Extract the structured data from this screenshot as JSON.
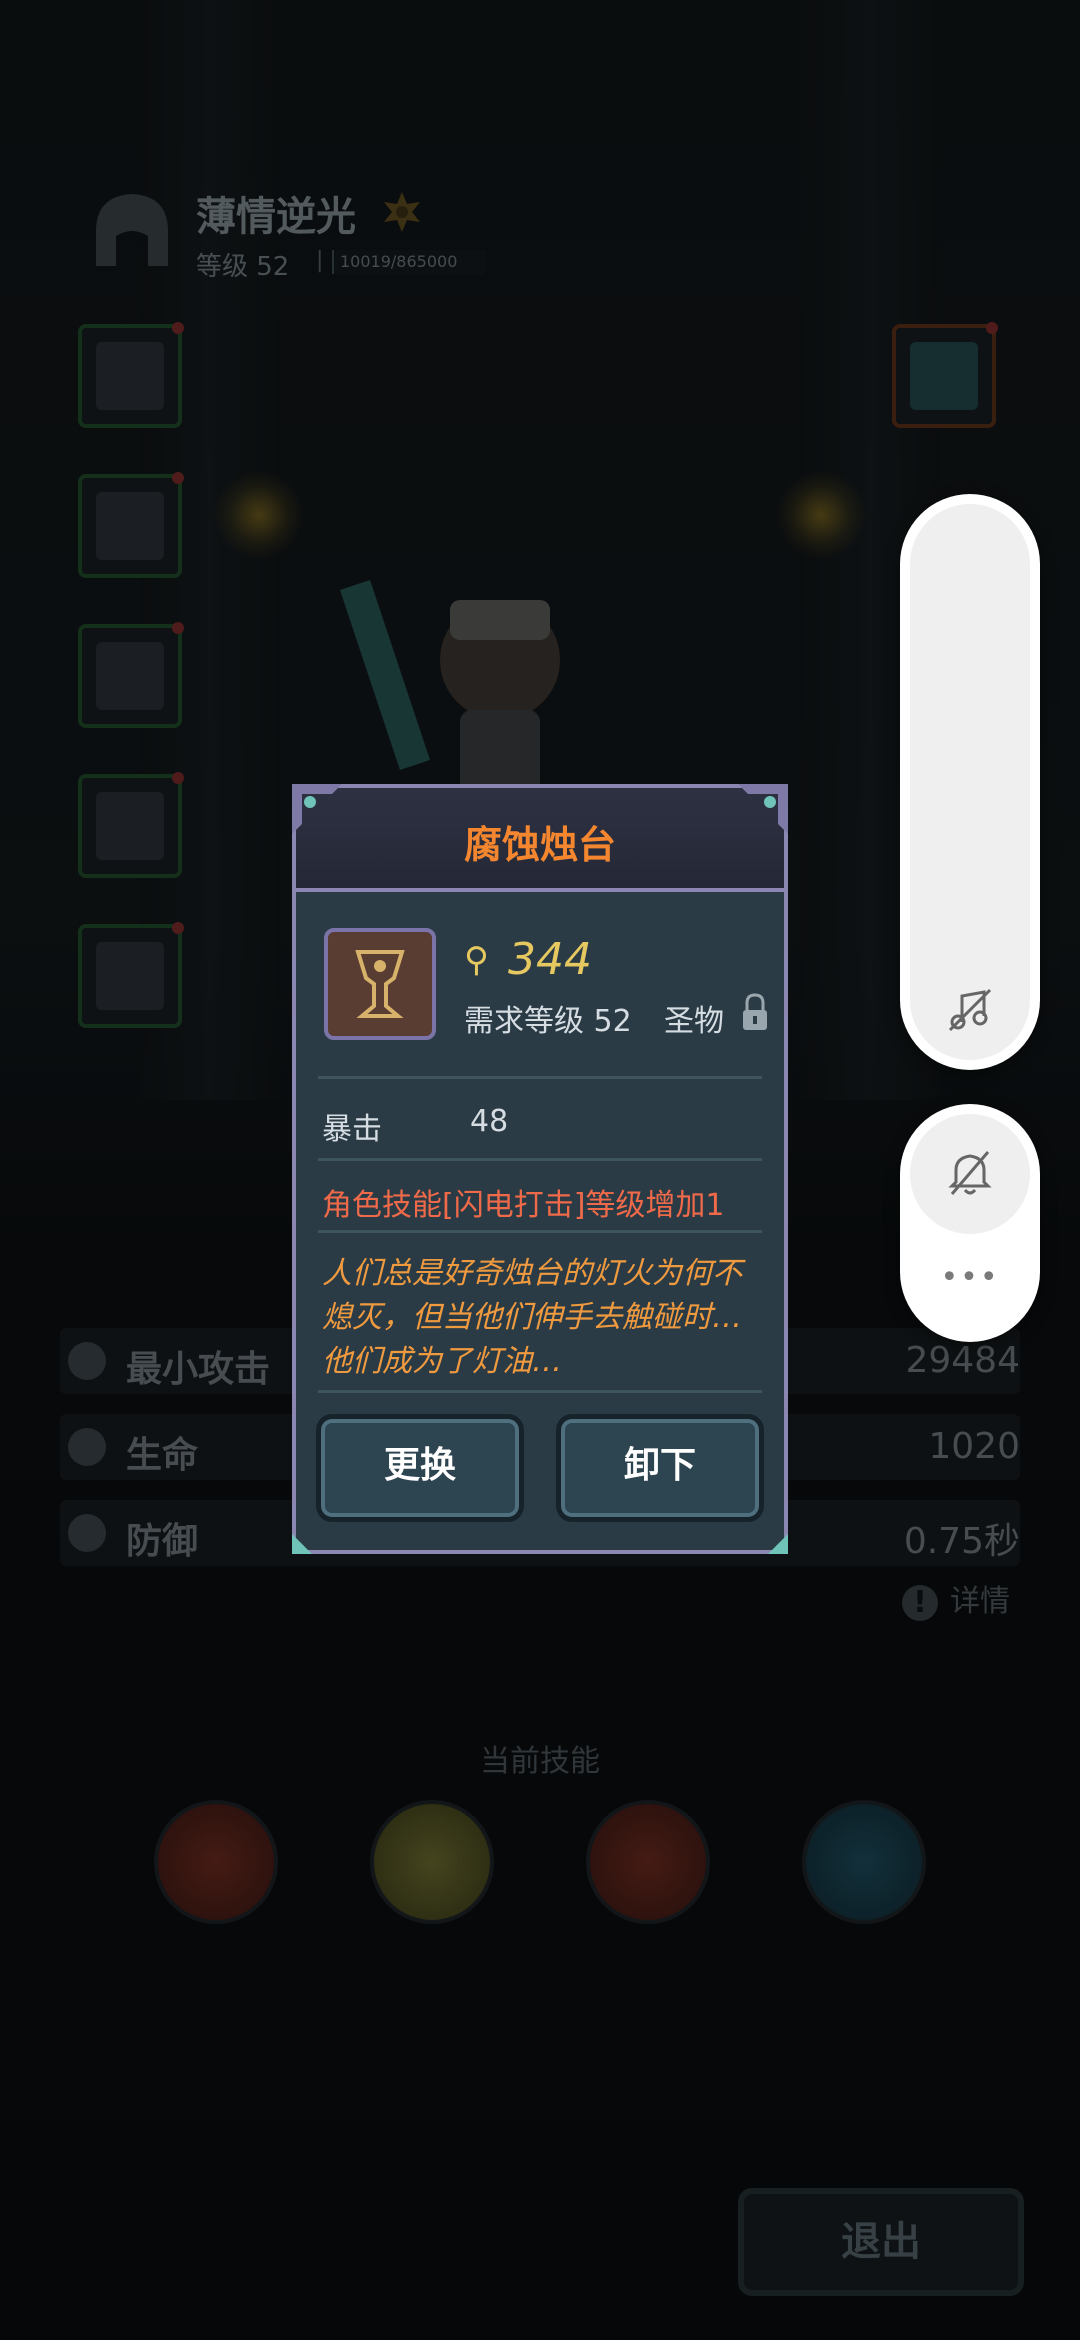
{
  "player": {
    "name": "薄情逆光",
    "level_label": "等级 52",
    "separator": "|",
    "exp_text": "10019/865000",
    "exp_progress": 0.0116
  },
  "stats": [
    {
      "label": "最小攻击",
      "value": "29484",
      "icon": "sword-icon"
    },
    {
      "label": "生命",
      "value": "1020",
      "icon": "heart-icon"
    },
    {
      "label": "防御",
      "value": "0.75秒",
      "icon": "shield-icon"
    }
  ],
  "detail_label": "详情",
  "skills_title": "当前技能",
  "exit_label": "退出",
  "modal": {
    "title": "腐蚀烛台",
    "power": "344",
    "required_level": "需求等级 52",
    "item_type": "圣物",
    "attribute_label": "暴击",
    "attribute_value": "48",
    "effect": "角色技能[闪电打击]等级增加1",
    "flavor_lines": [
      "人们总是好奇烛台的灯火为何不",
      "熄灭，但当他们伸手去触碰时…",
      "他们成为了灯油…"
    ],
    "replace_label": "更换",
    "unequip_label": "卸下"
  },
  "floating": {
    "more_label": "•••"
  },
  "colors": {
    "title_orange": "#f4862f",
    "power_gold": "#e6c860",
    "effect_red": "#f06a4a",
    "flavor_orange": "#f09a40",
    "modal_border": "#8c86b2"
  }
}
